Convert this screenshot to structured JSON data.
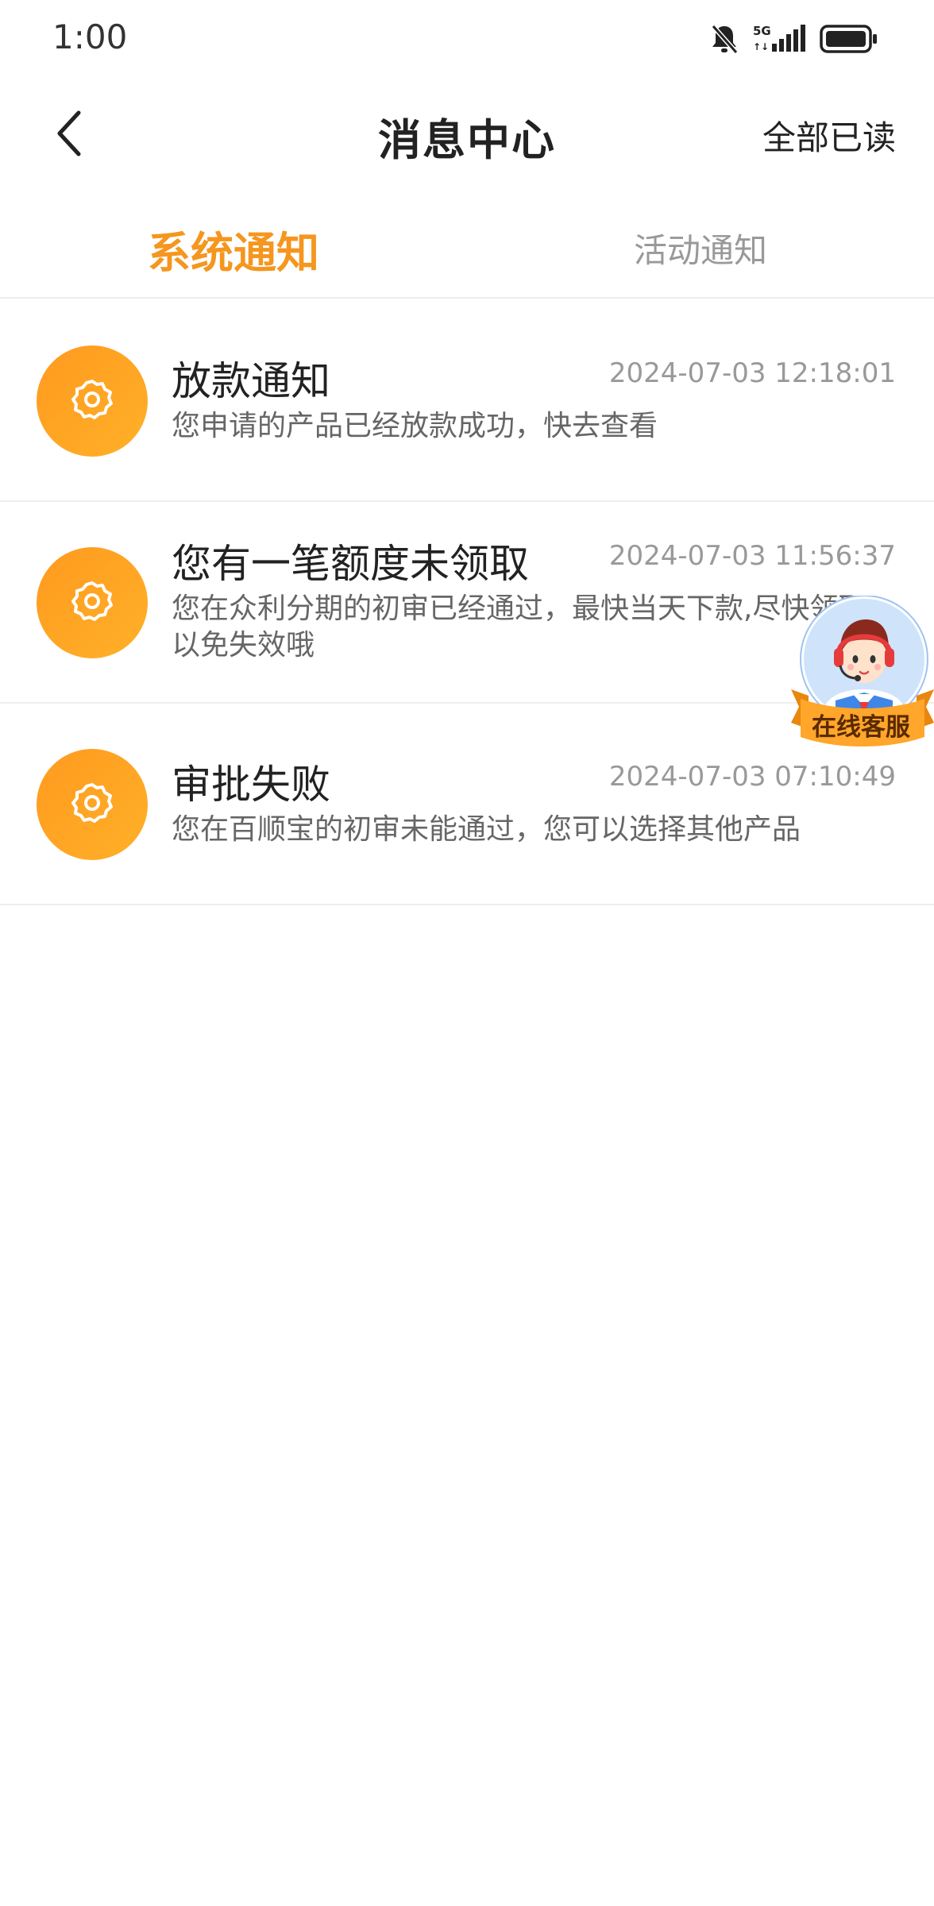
{
  "status_bar": {
    "time": "1:00",
    "network": "5G",
    "icons": [
      "bell-off-icon",
      "signal-icon",
      "battery-icon"
    ]
  },
  "header": {
    "title": "消息中心",
    "back_icon": "chevron-left-icon",
    "mark_all_read": "全部已读"
  },
  "tabs": [
    {
      "label": "系统通知",
      "active": true
    },
    {
      "label": "活动通知",
      "active": false
    }
  ],
  "messages": [
    {
      "title": "放款通知",
      "time": "2024-07-03 12:18:01",
      "desc": "您申请的产品已经放款成功，快去查看",
      "icon": "gear-icon"
    },
    {
      "title": "您有一笔额度未领取",
      "time": "2024-07-03 11:56:37",
      "desc": "您在众利分期的初审已经通过，最快当天下款,尽快领取以免失效哦",
      "icon": "gear-icon"
    },
    {
      "title": "审批失败",
      "time": "2024-07-03 07:10:49",
      "desc": "您在百顺宝的初审未能通过，您可以选择其他产品",
      "icon": "gear-icon"
    }
  ],
  "customer_service": {
    "label": "在线客服",
    "icon": "agent-avatar-icon"
  },
  "colors": {
    "accent": "#f5961e",
    "icon_bg_start": "#ff9a1f",
    "icon_bg_end": "#ffb028",
    "text_primary": "#222222",
    "text_secondary": "#666666",
    "text_muted": "#999999",
    "divider": "#eeeeee"
  }
}
